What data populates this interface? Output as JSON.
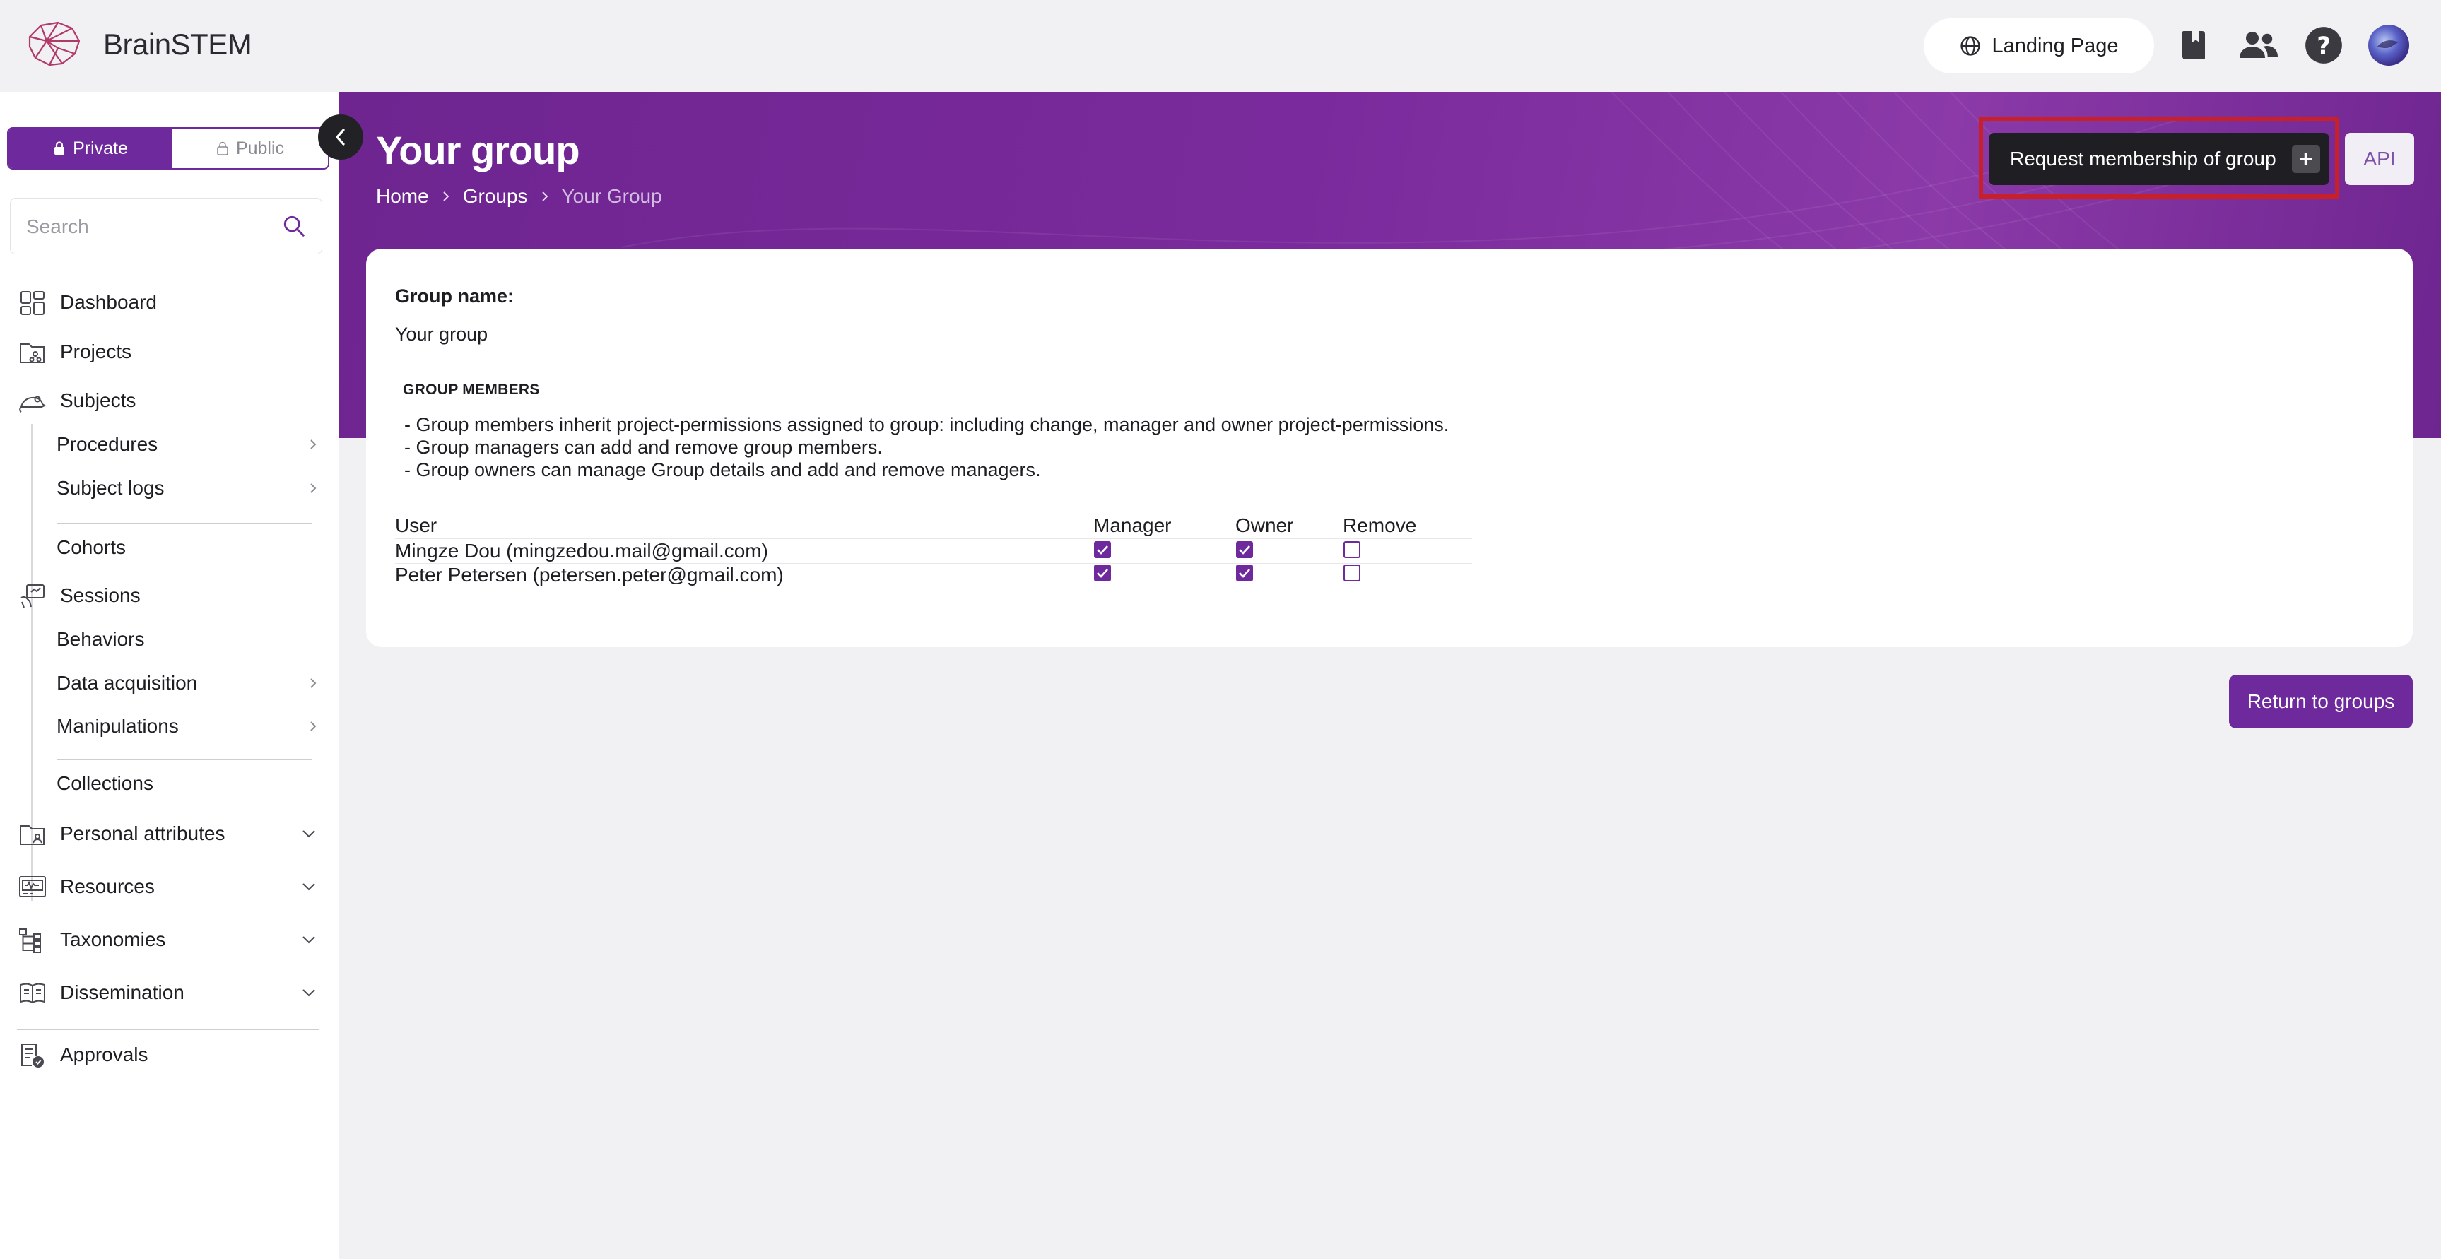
{
  "app": {
    "name": "BrainSTEM"
  },
  "topbar": {
    "landing_label": "Landing Page",
    "icons": [
      "book-icon",
      "users-icon",
      "help-icon",
      "avatar"
    ]
  },
  "sidebar": {
    "toggle": {
      "private": "Private",
      "public": "Public"
    },
    "search_placeholder": "Search",
    "items": {
      "dashboard": "Dashboard",
      "projects": "Projects",
      "subjects": "Subjects",
      "procedures": "Procedures",
      "subject_logs": "Subject logs",
      "cohorts": "Cohorts",
      "sessions": "Sessions",
      "behaviors": "Behaviors",
      "data_acquisition": "Data acquisition",
      "manipulations": "Manipulations",
      "collections": "Collections",
      "personal_attributes": "Personal attributes",
      "resources": "Resources",
      "taxonomies": "Taxonomies",
      "dissemination": "Dissemination",
      "approvals": "Approvals"
    }
  },
  "header": {
    "title": "Your group",
    "breadcrumb": [
      "Home",
      "Groups",
      "Your Group"
    ],
    "request_label": "Request membership of group",
    "request_plus": "+",
    "api_label": "API"
  },
  "group": {
    "name_label": "Group name:",
    "name_value": "Your group",
    "members_heading": "GROUP MEMBERS",
    "descriptions": [
      "- Group members inherit project-permissions assigned to group: including change, manager and owner project-permissions.",
      "- Group managers can add and remove group members.",
      "- Group owners can manage Group details and add and remove managers."
    ],
    "columns": [
      "User",
      "Manager",
      "Owner",
      "Remove"
    ],
    "members": [
      {
        "user": "Mingze Dou (mingzedou.mail@gmail.com)",
        "manager": true,
        "owner": true,
        "remove": false
      },
      {
        "user": "Peter Petersen (petersen.peter@gmail.com)",
        "manager": true,
        "owner": true,
        "remove": false
      }
    ]
  },
  "footer": {
    "return_label": "Return to groups"
  },
  "colors": {
    "accent": "#6e2a9c",
    "highlight": "#c8202a",
    "dark_button": "#1f1f23"
  }
}
